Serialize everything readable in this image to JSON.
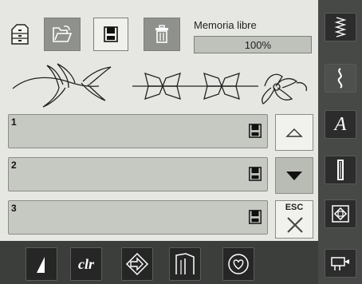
{
  "memory": {
    "label": "Memoria libre",
    "value": "100%",
    "fraction": 1.0
  },
  "toolbar": {
    "icons": [
      "drawer-icon",
      "folder-open-icon",
      "save-disk-icon",
      "trash-icon"
    ]
  },
  "slots": [
    {
      "number": "1"
    },
    {
      "number": "2"
    },
    {
      "number": "3"
    }
  ],
  "nav": {
    "esc_label": "ESC"
  },
  "bottombar": {
    "clr_label": "clr"
  },
  "sidebar": {
    "alpha_label": "A"
  },
  "colors": {
    "screen": "#e6e7e2",
    "frame": "#3c3e3c",
    "button_dark": "#8f918c"
  }
}
